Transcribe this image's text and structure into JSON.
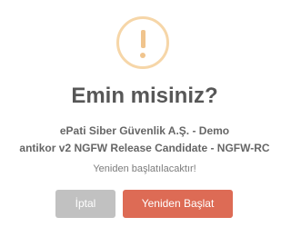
{
  "dialog": {
    "icon": "warning-icon",
    "title": "Emin misiniz?",
    "message_line_1": "ePati Siber Güvenlik A.Ş. - Demo",
    "message_line_2": "antikor v2 NGFW Release Candidate - NGFW-RC",
    "subtext": "Yeniden başlatılacaktır!",
    "cancel_label": "İptal",
    "confirm_label": "Yeniden Başlat"
  },
  "colors": {
    "warning": "#f0c48d",
    "confirm": "#dd6b55",
    "cancel": "#c1c1c1",
    "title": "#575757"
  }
}
